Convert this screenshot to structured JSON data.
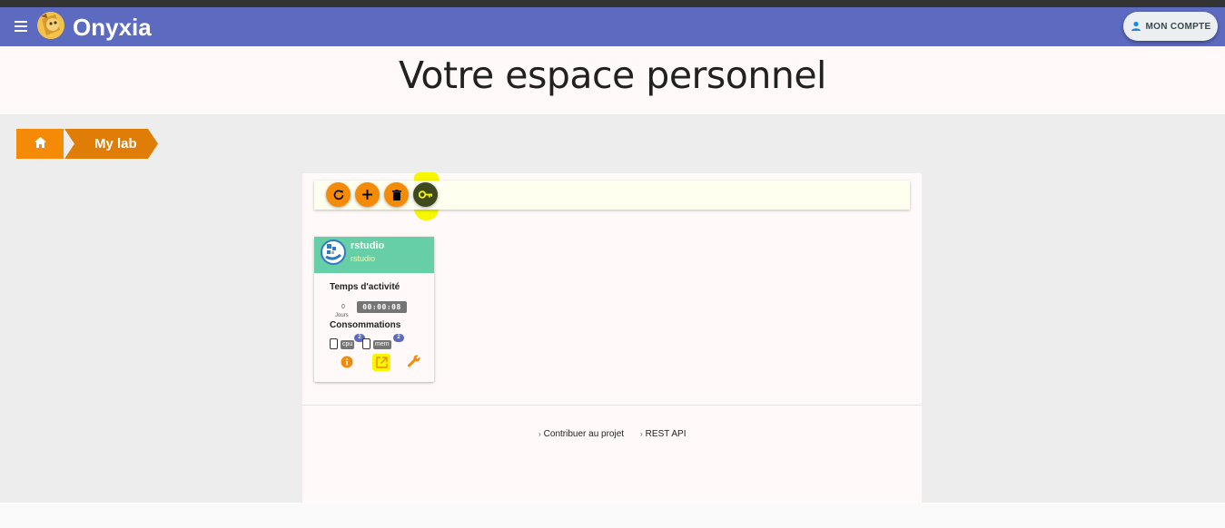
{
  "appbar": {
    "title": "Onyxia",
    "account_label": "MON COMPTE",
    "color": "#5c6bc0"
  },
  "hero": {
    "title": "Votre espace personnel"
  },
  "breadcrumb": {
    "items": [
      {
        "icon": "home-icon"
      },
      {
        "label": "My lab"
      }
    ],
    "color": "#f58a07"
  },
  "toolbar": {
    "buttons": [
      {
        "icon": "refresh-icon"
      },
      {
        "icon": "add-icon"
      },
      {
        "icon": "delete-icon"
      },
      {
        "icon": "key-icon",
        "highlighted": true
      }
    ]
  },
  "service": {
    "title": "rstudio",
    "subtitle": "rstudio",
    "uptime_label": "Temps d'activité",
    "days_value": "0",
    "days_label": "Jours",
    "timer": "00:00:08",
    "consumption_label": "Consommations",
    "resources": [
      {
        "name": "cpu",
        "count": "2"
      },
      {
        "name": "mem",
        "count": "2"
      }
    ],
    "actions": [
      {
        "icon": "info-icon"
      },
      {
        "icon": "open-in-new-icon",
        "highlighted": true
      },
      {
        "icon": "wrench-icon"
      }
    ],
    "header_color": "#66cfa7"
  },
  "footer": {
    "links": [
      {
        "label": "Contribuer au projet"
      },
      {
        "label": "REST API"
      }
    ]
  }
}
